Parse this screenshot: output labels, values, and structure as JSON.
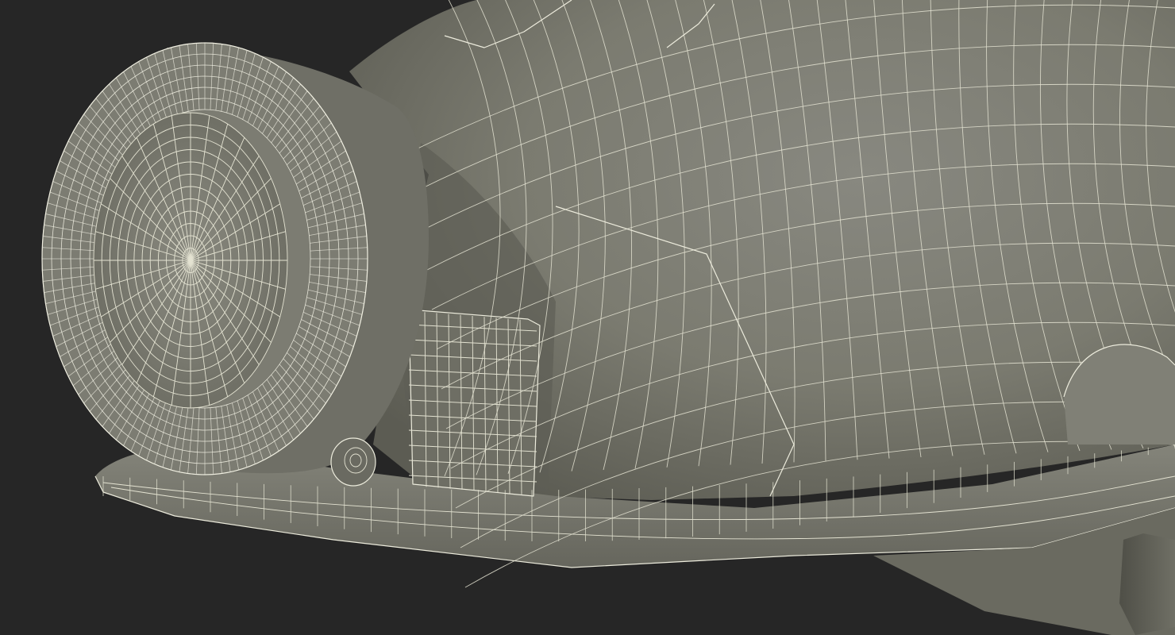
{
  "scene": {
    "background_color": "#262626",
    "surface_color": "#7b7b70",
    "surface_shadow_color": "#55554c",
    "wireframe_color": "#ecebdc",
    "subject": "hard-hat-with-headlamp-wireframe-render"
  }
}
